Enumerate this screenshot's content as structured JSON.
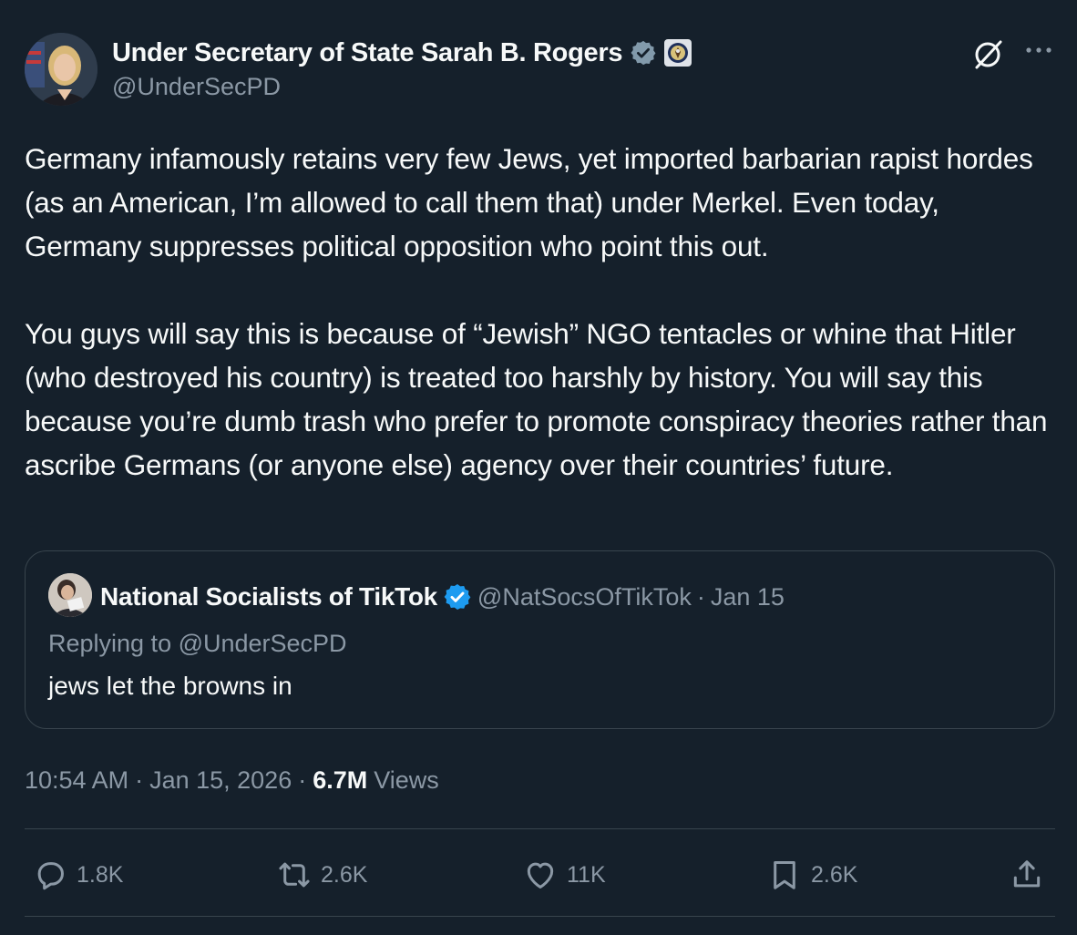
{
  "author": {
    "display_name": "Under Secretary of State Sarah B. Rogers",
    "handle": "@UnderSecPD"
  },
  "tweet": {
    "paragraphs": [
      "Germany infamously retains very few Jews, yet imported barbarian rapist hordes (as an American, I’m allowed to call them that) under Merkel. Even today, Germany suppresses political opposition who point this out.",
      "You guys will say this is because of “Jewish” NGO tentacles or whine that Hitler (who destroyed his country) is treated too harshly by history.   You will say this because you’re dumb trash who prefer to promote conspiracy theories rather than ascribe Germans (or anyone else) agency over their countries’ future."
    ]
  },
  "quote": {
    "display_name": "National Socialists of TikTok",
    "handle": "@NatSocsOfTikTok",
    "separator": "·",
    "date": "Jan 15",
    "replying_to": "Replying to @UnderSecPD",
    "text": "jews let the browns in"
  },
  "meta": {
    "time": "10:54 AM",
    "separator": "·",
    "date": "Jan 15, 2026",
    "views_count": "6.7M",
    "views_label": "Views"
  },
  "actions": {
    "replies": "1.8K",
    "reposts": "2.6K",
    "likes": "11K",
    "bookmarks": "2.6K"
  },
  "colors": {
    "background": "#15202b",
    "text": "#f7f9f9",
    "secondary": "#8b98a5",
    "border": "#38444d",
    "verified_gray": "#829aab",
    "verified_blue": "#1d9bf0"
  }
}
